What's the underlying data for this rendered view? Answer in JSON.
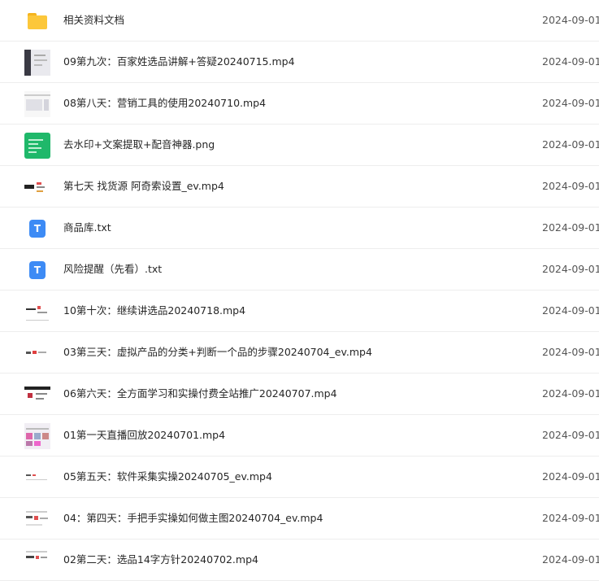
{
  "files": [
    {
      "name": "相关资料文档",
      "date": "2024-09-01",
      "icon": "folder-icon"
    },
    {
      "name": "09第九次：百家姓选品讲解+答疑20240715.mp4",
      "date": "2024-09-01",
      "icon": "video-thumbnail-icon"
    },
    {
      "name": "08第八天：营销工具的使用20240710.mp4",
      "date": "2024-09-01",
      "icon": "video-thumbnail-icon"
    },
    {
      "name": "去水印+文案提取+配音神器.png",
      "date": "2024-09-01",
      "icon": "image-thumbnail-icon"
    },
    {
      "name": "第七天 找货源 阿奇索设置_ev.mp4",
      "date": "2024-09-01",
      "icon": "video-thumbnail-icon"
    },
    {
      "name": "商品库.txt",
      "date": "2024-09-01",
      "icon": "txt-file-icon"
    },
    {
      "name": "风险提醒（先看）.txt",
      "date": "2024-09-01",
      "icon": "txt-file-icon"
    },
    {
      "name": "10第十次：继续讲选品20240718.mp4",
      "date": "2024-09-01",
      "icon": "video-thumbnail-icon"
    },
    {
      "name": "03第三天：虚拟产品的分类+判断一个品的步骤20240704_ev.mp4",
      "date": "2024-09-01",
      "icon": "video-thumbnail-icon"
    },
    {
      "name": "06第六天：全方面学习和实操付费全站推广20240707.mp4",
      "date": "2024-09-01",
      "icon": "video-thumbnail-icon"
    },
    {
      "name": "01第一天直播回放20240701.mp4",
      "date": "2024-09-01",
      "icon": "video-thumbnail-icon"
    },
    {
      "name": "05第五天：软件采集实操20240705_ev.mp4",
      "date": "2024-09-01",
      "icon": "video-thumbnail-icon"
    },
    {
      "name": "04：第四天：手把手实操如何做主图20240704_ev.mp4",
      "date": "2024-09-01",
      "icon": "video-thumbnail-icon"
    },
    {
      "name": "02第二天：选品14字方针20240702.mp4",
      "date": "2024-09-01",
      "icon": "video-thumbnail-icon"
    }
  ],
  "txt_icon_letter": "T",
  "colors": {
    "folder": "#fcc73a",
    "txt_icon": "#3d8bf5",
    "image_icon": "#1fb86a",
    "divider": "#ededed"
  }
}
